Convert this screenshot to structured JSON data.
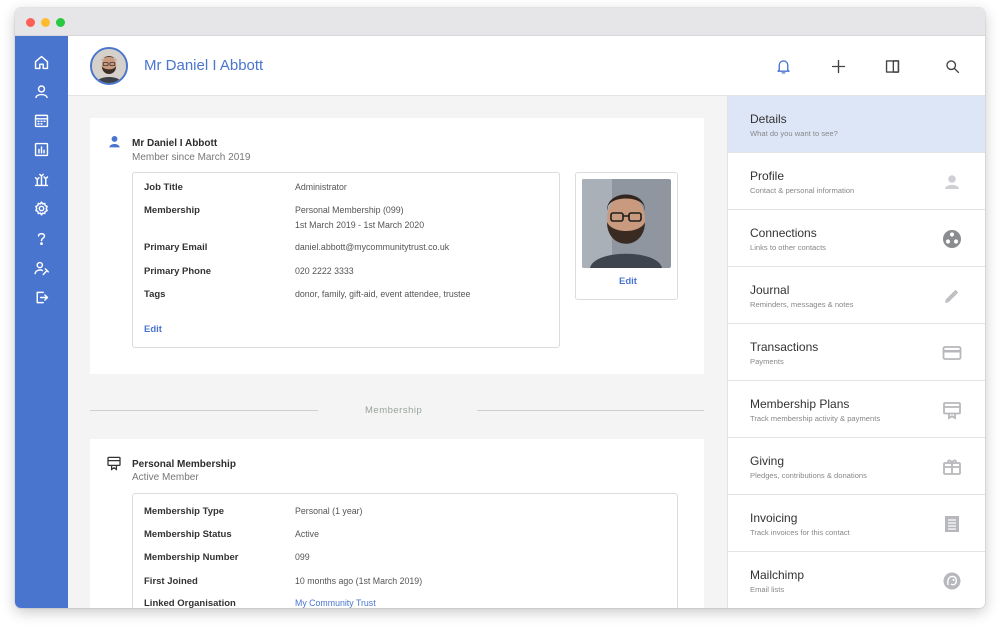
{
  "contact": {
    "name": "Mr Daniel I Abbott",
    "member_since": "Member since March 2019"
  },
  "details": {
    "rows": [
      {
        "label": "Job Title",
        "value": "Administrator"
      },
      {
        "label": "Membership",
        "value": "Personal Membership (099)",
        "value2": "1st March 2019 - 1st March 2020"
      },
      {
        "label": "Primary Email",
        "value": "daniel.abbott@mycommunitytrust.co.uk"
      },
      {
        "label": "Primary Phone",
        "value": "020 2222 3333"
      },
      {
        "label": "Tags",
        "value": "donor, family, gift-aid, event attendee, trustee"
      }
    ],
    "edit_label": "Edit",
    "photo_edit_label": "Edit"
  },
  "section_divider": "Membership",
  "membership": {
    "title": "Personal Membership",
    "subtitle": "Active Member",
    "rows": [
      {
        "label": "Membership Type",
        "value": "Personal (1 year)"
      },
      {
        "label": "Membership Status",
        "value": "Active"
      },
      {
        "label": "Membership Number",
        "value": "099"
      },
      {
        "label": "First Joined",
        "value": "10 months ago (1st March 2019)"
      },
      {
        "label": "Linked Organisation",
        "value": "My Community Trust"
      }
    ]
  },
  "panel": {
    "items": [
      {
        "title": "Details",
        "subtitle": "What do you want to see?",
        "icon": "none"
      },
      {
        "title": "Profile",
        "subtitle": "Contact & personal information",
        "icon": "person-icon"
      },
      {
        "title": "Connections",
        "subtitle": "Links to other contacts",
        "icon": "connections-icon"
      },
      {
        "title": "Journal",
        "subtitle": "Reminders, messages & notes",
        "icon": "pencil-icon"
      },
      {
        "title": "Transactions",
        "subtitle": "Payments",
        "icon": "card-icon"
      },
      {
        "title": "Membership Plans",
        "subtitle": "Track membership activity & payments",
        "icon": "membership-card-icon"
      },
      {
        "title": "Giving",
        "subtitle": "Pledges, contributions & donations",
        "icon": "gift-icon"
      },
      {
        "title": "Invoicing",
        "subtitle": "Track invoices for this contact",
        "icon": "invoice-icon"
      },
      {
        "title": "Mailchimp",
        "subtitle": "Email lists",
        "icon": "mailchimp-icon"
      }
    ]
  },
  "colors": {
    "accent": "#4a75cf",
    "rail": "#4a75cf",
    "active_panel": "#dde6f7"
  }
}
